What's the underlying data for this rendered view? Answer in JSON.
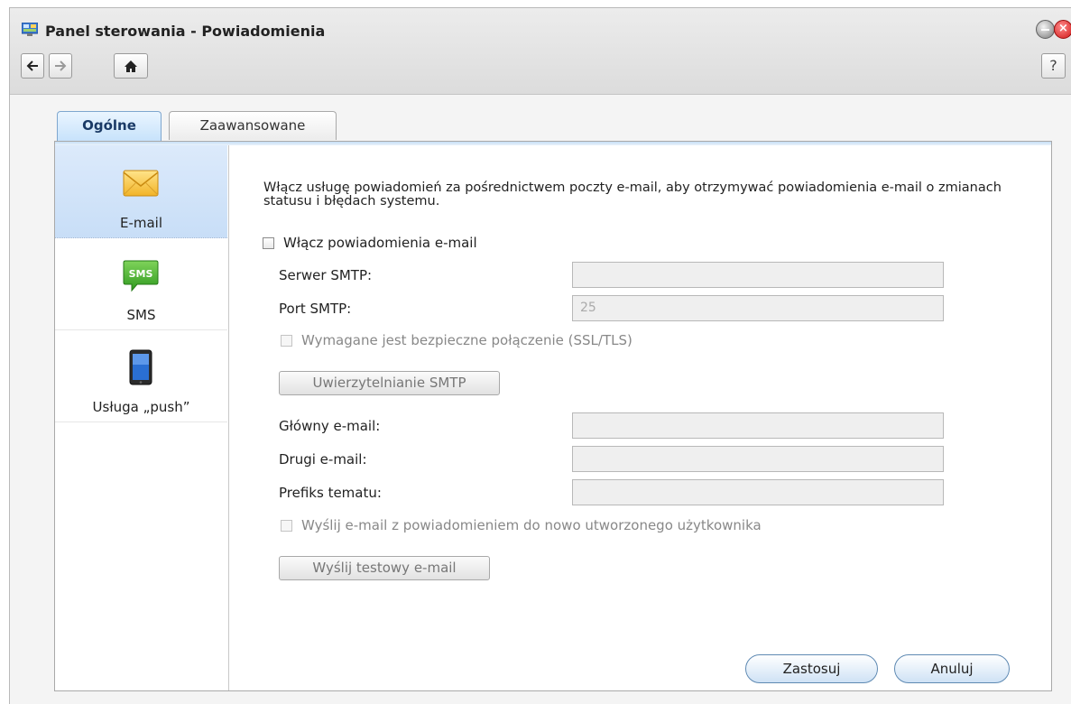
{
  "window": {
    "title": "Panel sterowania - Powiadomienia",
    "help_label": "?",
    "close_glyph": "×"
  },
  "toolbar": {
    "back_icon": "arrow-left-icon",
    "forward_icon": "arrow-right-icon",
    "home_icon": "home-icon"
  },
  "tabs": [
    {
      "label": "Ogólne",
      "active": true
    },
    {
      "label": "Zaawansowane",
      "active": false
    }
  ],
  "sidebar": {
    "items": [
      {
        "label": "E-mail",
        "icon": "envelope-icon",
        "active": true
      },
      {
        "label": "SMS",
        "icon": "sms-bubble-icon",
        "icon_text": "SMS",
        "active": false
      },
      {
        "label": "Usługa „push”",
        "icon": "mobile-device-icon",
        "active": false
      }
    ]
  },
  "email": {
    "description": "Włącz usługę powiadomień za pośrednictwem poczty e-mail, aby otrzymywać powiadomienia e-mail o zmianach statusu i błędach systemu.",
    "enable_label": "Włącz powiadomienia e-mail",
    "enable_checked": false,
    "smtp_server_label": "Serwer SMTP:",
    "smtp_server_value": "",
    "smtp_port_label": "Port SMTP:",
    "smtp_port_value": "25",
    "ssl_label": "Wymagane jest bezpieczne połączenie (SSL/TLS)",
    "ssl_checked": false,
    "smtp_auth_button": "Uwierzytelnianie SMTP",
    "primary_email_label": "Główny e-mail:",
    "primary_email_value": "",
    "secondary_email_label": "Drugi e-mail:",
    "secondary_email_value": "",
    "subject_prefix_label": "Prefiks tematu:",
    "subject_prefix_value": "",
    "new_user_label": "Wyślij e-mail z powiadomieniem do nowo utworzonego użytkownika",
    "new_user_checked": false,
    "test_button": "Wyślij testowy e-mail"
  },
  "actions": {
    "apply": "Zastosuj",
    "cancel": "Anuluj"
  },
  "colors": {
    "accent": "#1a3a66",
    "active_bg": "#c8def7",
    "close_red": "#d01818"
  }
}
